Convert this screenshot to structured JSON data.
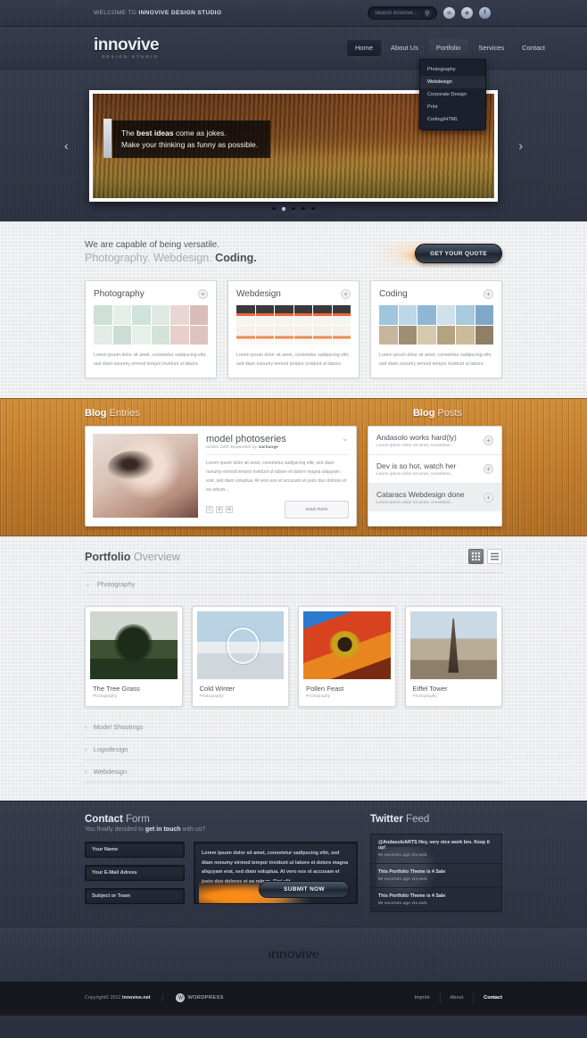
{
  "topbar": {
    "welcome_prefix": "WELCOME TO ",
    "welcome_brand": "INNOVIVE DESIGN STUDIO",
    "search_placeholder": "Search innovive...",
    "search_value": "",
    "search_icon": "search-icon",
    "social": [
      {
        "name": "dribbble-icon",
        "glyph": "◕"
      },
      {
        "name": "twitter-icon",
        "glyph": "✉"
      },
      {
        "name": "facebook-icon",
        "glyph": "f"
      }
    ]
  },
  "header": {
    "logo": "innovive",
    "logo_sub": "DESIGN STUDIO",
    "nav": [
      {
        "label": "Home",
        "state": "active"
      },
      {
        "label": "About Us",
        "state": "normal"
      },
      {
        "label": "Portfolio",
        "state": "open"
      },
      {
        "label": "Services",
        "state": "normal"
      },
      {
        "label": "Contact",
        "state": "normal"
      }
    ],
    "dropdown": [
      {
        "label": "Photography",
        "highlight": false
      },
      {
        "label": "Webdesign",
        "highlight": true
      },
      {
        "label": "Corporate Design",
        "highlight": false
      },
      {
        "label": "Print",
        "highlight": false
      },
      {
        "label": "Coding/HTML",
        "highlight": false
      }
    ]
  },
  "slider": {
    "prev_arrow": "‹",
    "next_arrow": "›",
    "caption_line1_a": "The ",
    "caption_line1_b": "best ideas",
    "caption_line1_c": " come as jokes.",
    "caption_line2": "Make your thinking as funny as possible.",
    "dots_total": 5,
    "dot_active_index": 1
  },
  "intro": {
    "tagline1": "We are capable of being versatile.",
    "tagline2_light": "Photography. Webdesign. ",
    "tagline2_bold": "Coding.",
    "quote_button": "GET YOUR QUOTE"
  },
  "services": [
    {
      "title": "Photography",
      "palette": "pg",
      "text": "Lorem ipsum dolor sit amet, consetetur sadipscing elitr, sed diam nonumy eirmod tempor invidunt ut labore.",
      "plus": "+"
    },
    {
      "title": "Webdesign",
      "palette": "wd",
      "text": "Lorem ipsum dolor sit amet, consetetur sadipscing elitr, sed diam nonumy eirmod tempor invidunt ut labore.",
      "plus": "+"
    },
    {
      "title": "Coding",
      "palette": "cd",
      "text": "Lorem ipsum dolor sit amet, consetetur sadipscing elitr, sed diam nonumy eirmod tempor invidunt ut labore.",
      "plus": "+"
    }
  ],
  "blog": {
    "entries_title_bold": "Blog",
    "entries_title_light": " Entries",
    "posts_title_bold": "Blog",
    "posts_title_light": " Posts",
    "entry": {
      "title": "model photoseries",
      "chevron": "⌄",
      "meta_prefix": "written ",
      "meta_date": "22th September",
      "meta_by": " by ",
      "meta_author": "xachange",
      "text": "Lorem ipsum dolor sit amet, consetetur sadipscing elitr, sed diam nonumy eirmod tempor invidunt ut labore et dolore magna aliquyam erat, sed diam voluptua. At vero eos et accusam et justo duo dolores et ea rebum...",
      "share_icons": [
        "facebook-share-icon",
        "flickr-share-icon",
        "rss-share-icon"
      ],
      "share_glyphs": [
        "f",
        "b",
        "≋"
      ],
      "read_more": "read more"
    },
    "posts": [
      {
        "title": "Andasolo works hard(ly)",
        "excerpt": "Lorem ipsum dolor sit amet, consetetur...",
        "plus": "+"
      },
      {
        "title": "Dev is so hot, watch her",
        "excerpt": "Lorem ipsum dolor sit amet, consetetur...",
        "plus": "+"
      },
      {
        "title": "Cataracs Webdesign done",
        "excerpt": "Lorem ipsum dolor sit amet, consetetur...",
        "plus": "+"
      }
    ]
  },
  "portfolio": {
    "title_bold": "Portfolio",
    "title_light": " Overview",
    "view_grid_icon": "grid-view-icon",
    "view_list_icon": "list-view-icon",
    "open_category": {
      "label": "Photography",
      "chevron": "⌄"
    },
    "items": [
      {
        "name": "The Tree Grass",
        "category": "Photography",
        "image": "im1"
      },
      {
        "name": "Cold Winter",
        "category": "Photography",
        "image": "im2"
      },
      {
        "name": "Pollen Feast",
        "category": "Photography",
        "image": "im3"
      },
      {
        "name": "Eiffel Tower",
        "category": "Photography",
        "image": "im4"
      }
    ],
    "closed_categories": [
      {
        "label": "Model Shootings",
        "chevron": "›"
      },
      {
        "label": "Logodesign",
        "chevron": "›"
      },
      {
        "label": "Webdesign",
        "chevron": "›"
      }
    ]
  },
  "contact": {
    "title_bold": "Contact",
    "title_light": " Form",
    "sub_a": "You finally decided to ",
    "sub_b": "get in touch",
    "sub_c": " with us?",
    "fields": [
      {
        "name": "name-field",
        "placeholder": "Your Name",
        "value": ""
      },
      {
        "name": "email-field",
        "placeholder": "Your E-Mail Adress",
        "value": ""
      },
      {
        "name": "subject-field",
        "placeholder": "Subject or Team",
        "value": ""
      }
    ],
    "message_value": "Lorem ipsum dolor sit amet, consetetur sadipscing elitr, sed diam nonumy eirmod tempor invidunt ut labore et dolore magna aliquyam erat, sed diam voluptua. At vero eos et accusam et justo duo dolores et ea rebum. Stet clit",
    "submit": "SUBMIT NOW"
  },
  "twitter": {
    "title_bold": "Twitter",
    "title_light": " Feed",
    "tweets": [
      {
        "text": "@AndasoloARTS Hey, very nice work bro. Keep it up!",
        "meta": "60 seconds ago via web"
      },
      {
        "text": "This Portfolio Theme is 4 Sale",
        "meta": "60 seconds ago via web"
      },
      {
        "text": "This Portfolio Theme is 4 Sale",
        "meta": "60 seconds ago via web"
      }
    ]
  },
  "bottom_logo": "innovive",
  "footer": {
    "copyright_prefix": "Copyright© 2012 ",
    "copyright_brand": "innovive.net",
    "wordpress": "WORDPRESS",
    "wordpress_glyph": "Ⓦ",
    "links": [
      {
        "label": "Imprint",
        "bold": false
      },
      {
        "label": "About",
        "bold": false
      },
      {
        "label": "Contact",
        "bold": true
      }
    ]
  },
  "colors": {
    "dark": "#2f3442",
    "wood": "#c8822f",
    "light": "#e9eaec",
    "accent_orange": "#e8663a"
  }
}
